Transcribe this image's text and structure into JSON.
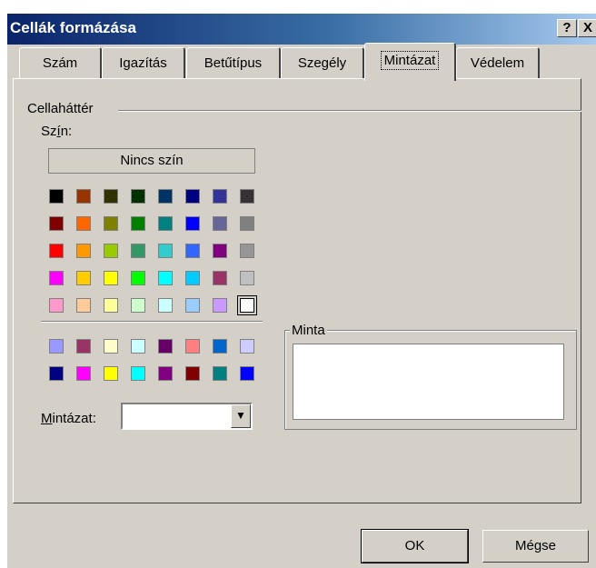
{
  "window": {
    "title": "Cellák formázása",
    "help_label": "?",
    "close_label": "X"
  },
  "tabs": [
    {
      "label": "Szám"
    },
    {
      "label": "Igazítás"
    },
    {
      "label": "Betűtípus"
    },
    {
      "label": "Szegély"
    },
    {
      "label": "Mintázat",
      "active": true
    },
    {
      "label": "Védelem"
    }
  ],
  "cell_background": {
    "group_label": "Cellaháttér",
    "color_label": "Szín:",
    "no_color_label": "Nincs szín",
    "palette_main": [
      [
        "#000000",
        "#993300",
        "#333300",
        "#003300",
        "#003366",
        "#000080",
        "#333399",
        "#333333"
      ],
      [
        "#800000",
        "#ff6600",
        "#808000",
        "#008000",
        "#008080",
        "#0000ff",
        "#666699",
        "#808080"
      ],
      [
        "#ff0000",
        "#ff9900",
        "#99cc00",
        "#339966",
        "#33cccc",
        "#3366ff",
        "#800080",
        "#969696"
      ],
      [
        "#ff00ff",
        "#ffcc00",
        "#ffff00",
        "#00ff00",
        "#00ffff",
        "#00ccff",
        "#993366",
        "#c0c0c0"
      ],
      [
        "#ff99cc",
        "#ffcc99",
        "#ffff99",
        "#ccffcc",
        "#ccffff",
        "#99ccff",
        "#cc99ff",
        "#ffffff"
      ]
    ],
    "palette_extra": [
      [
        "#9999ff",
        "#993366",
        "#ffffcc",
        "#ccffff",
        "#660066",
        "#ff8080",
        "#0066cc",
        "#ccccff"
      ],
      [
        "#000080",
        "#ff00ff",
        "#ffff00",
        "#00ffff",
        "#800080",
        "#800000",
        "#008080",
        "#0000ff"
      ]
    ],
    "selected_color": "#ffffff",
    "pattern_label": "Mintázat:",
    "pattern_value": ""
  },
  "sample": {
    "label": "Minta"
  },
  "buttons": {
    "ok": "OK",
    "cancel": "Mégse"
  }
}
